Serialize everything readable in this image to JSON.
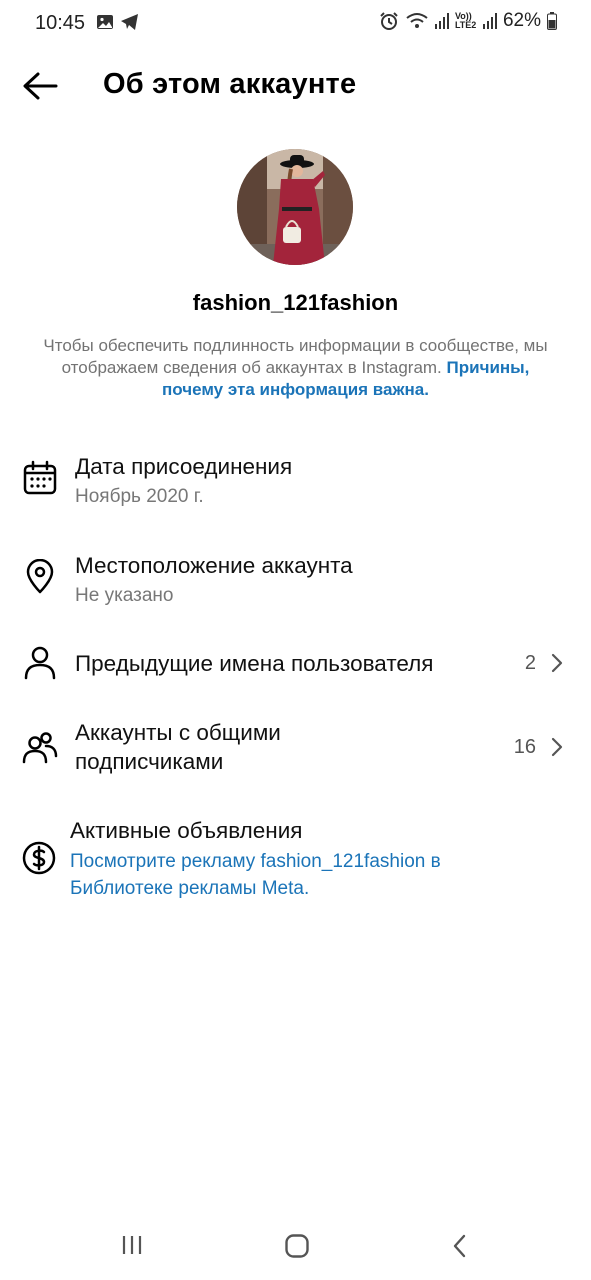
{
  "status_bar": {
    "time": "10:45",
    "network_label": "Vo)) LTE2",
    "battery": "62%",
    "icons": [
      "gallery-icon",
      "telegram-icon",
      "alarm-icon",
      "wifi-icon",
      "signal-icon",
      "battery-icon"
    ]
  },
  "header": {
    "title": "Об этом аккаунте"
  },
  "profile": {
    "username": "fashion_121fashion",
    "description": "Чтобы обеспечить подлинность информации в сообществе, мы отображаем сведения об аккаунтах в Instagram.",
    "link_text": "Причины, почему эта информация важна."
  },
  "items": {
    "join_date": {
      "label": "Дата присоединения",
      "value": "Ноябрь 2020 г."
    },
    "location": {
      "label": "Местоположение аккаунта",
      "value": "Не указано"
    },
    "former_usernames": {
      "label": "Предыдущие имена пользователя",
      "count": "2"
    },
    "shared_followers": {
      "label_line1": "Аккаунты с общими",
      "label_line2": "подписчиками",
      "count": "16"
    },
    "active_ads": {
      "label": "Активные объявления",
      "link_line1": "Посмотрите рекламу fashion_121fashion в",
      "link_line2": "Библиотеке рекламы Meta."
    }
  },
  "colors": {
    "link": "#1b74b8",
    "secondary_text": "#737373",
    "dress": "#a3243b"
  }
}
